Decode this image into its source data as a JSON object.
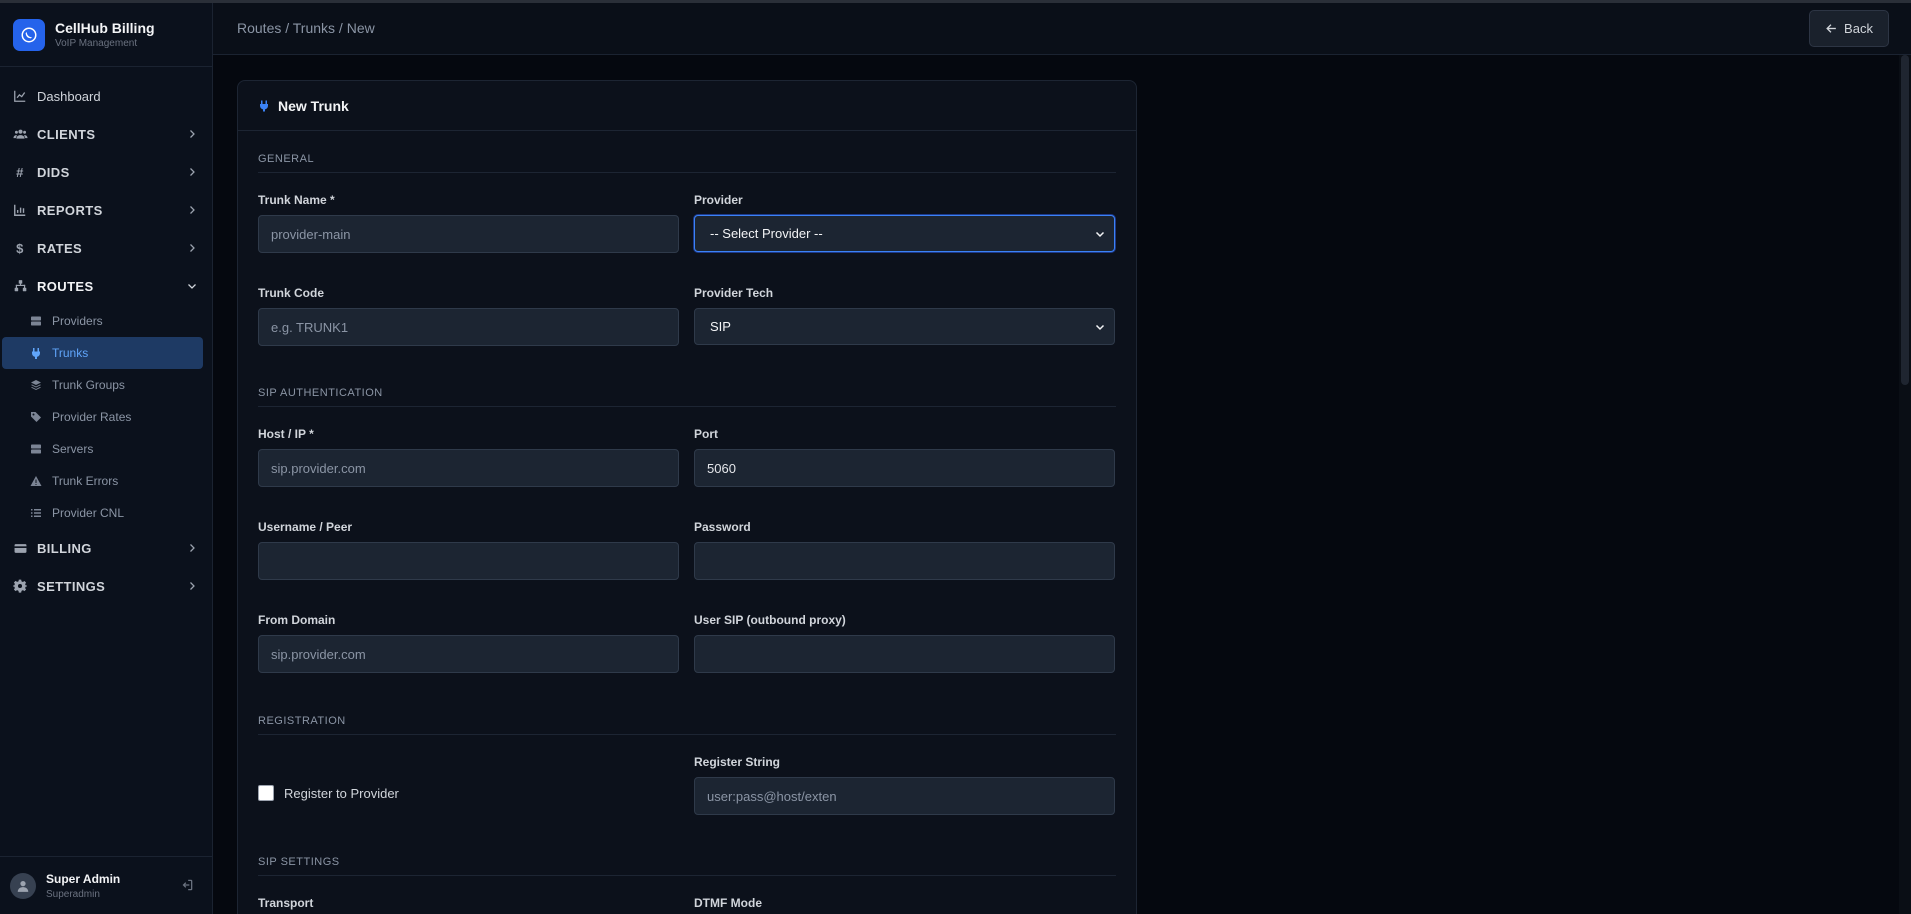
{
  "brand": {
    "title": "CellHub Billing",
    "subtitle": "VoIP Management"
  },
  "sidebar": {
    "items": [
      {
        "label": "Dashboard",
        "icon": "chart-line-icon"
      },
      {
        "label": "CLIENTS",
        "icon": "users-icon"
      },
      {
        "label": "DIDS",
        "icon": "hash-icon"
      },
      {
        "label": "REPORTS",
        "icon": "chart-bar-icon"
      },
      {
        "label": "RATES",
        "icon": "dollar-icon"
      },
      {
        "label": "ROUTES",
        "icon": "sitemap-icon"
      }
    ],
    "routes_sub": [
      {
        "label": "Providers",
        "icon": "server-icon"
      },
      {
        "label": "Trunks",
        "icon": "plug-icon"
      },
      {
        "label": "Trunk Groups",
        "icon": "layers-icon"
      },
      {
        "label": "Provider Rates",
        "icon": "tags-icon"
      },
      {
        "label": "Servers",
        "icon": "server-icon"
      },
      {
        "label": "Trunk Errors",
        "icon": "warning-icon"
      },
      {
        "label": "Provider CNL",
        "icon": "list-icon"
      }
    ],
    "bottom_items": [
      {
        "label": "BILLING",
        "icon": "credit-card-icon"
      },
      {
        "label": "SETTINGS",
        "icon": "gear-icon"
      }
    ]
  },
  "user": {
    "name": "Super Admin",
    "role": "Superadmin"
  },
  "header": {
    "breadcrumb": "Routes / Trunks / New",
    "back_label": "Back"
  },
  "card": {
    "title": "New Trunk",
    "sections": {
      "general": "GENERAL",
      "sip_auth": "SIP AUTHENTICATION",
      "registration": "REGISTRATION",
      "sip_settings": "SIP SETTINGS"
    },
    "fields": {
      "trunk_name": {
        "label": "Trunk Name *",
        "value": "",
        "placeholder": "provider-main"
      },
      "provider": {
        "label": "Provider",
        "value": "-- Select Provider --"
      },
      "trunk_code": {
        "label": "Trunk Code",
        "value": "",
        "placeholder": "e.g. TRUNK1"
      },
      "provider_tech": {
        "label": "Provider Tech",
        "value": "SIP"
      },
      "host": {
        "label": "Host / IP *",
        "value": "",
        "placeholder": "sip.provider.com"
      },
      "port": {
        "label": "Port",
        "value": "5060",
        "placeholder": ""
      },
      "username": {
        "label": "Username / Peer",
        "value": "",
        "placeholder": ""
      },
      "password": {
        "label": "Password",
        "value": "",
        "placeholder": ""
      },
      "from_domain": {
        "label": "From Domain",
        "value": "",
        "placeholder": "sip.provider.com"
      },
      "user_sip": {
        "label": "User SIP (outbound proxy)",
        "value": "",
        "placeholder": ""
      },
      "register_string": {
        "label": "Register String",
        "value": "",
        "placeholder": "user:pass@host/exten"
      },
      "transport": {
        "label": "Transport"
      },
      "dtmf_mode": {
        "label": "DTMF Mode"
      }
    },
    "register_checkbox": {
      "label": "Register to Provider",
      "checked": false
    }
  },
  "colors": {
    "accent": "#2563eb",
    "active_bg": "#1e3a64",
    "active_text": "#60a5fa",
    "background": "#05080f"
  }
}
